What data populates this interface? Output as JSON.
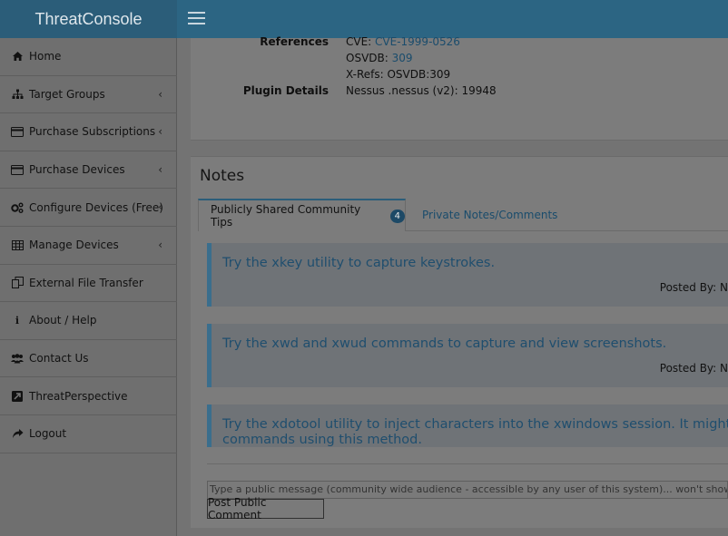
{
  "app": {
    "title": "ThreatConsole"
  },
  "sidebar": {
    "items": [
      {
        "label": "Home",
        "icon": "home-icon",
        "chevron": false
      },
      {
        "label": "Target Groups",
        "icon": "sitemap-icon",
        "chevron": true
      },
      {
        "label": "Purchase Subscriptions",
        "icon": "credit-card-icon",
        "chevron": true
      },
      {
        "label": "Purchase Devices",
        "icon": "credit-card-icon",
        "chevron": true
      },
      {
        "label": "Configure Devices (Free)",
        "icon": "gears-icon",
        "chevron": true
      },
      {
        "label": "Manage Devices",
        "icon": "table-icon",
        "chevron": true
      },
      {
        "label": "External File Transfer",
        "icon": "copy-icon",
        "chevron": false
      },
      {
        "label": "About / Help",
        "icon": "info-icon",
        "chevron": false
      },
      {
        "label": "Contact Us",
        "icon": "users-icon",
        "chevron": false
      },
      {
        "label": "ThreatPerspective",
        "icon": "external-link-icon",
        "chevron": false
      },
      {
        "label": "Logout",
        "icon": "share-icon",
        "chevron": false
      }
    ]
  },
  "references": {
    "label": "References",
    "cve_prefix": "CVE: ",
    "cve_link": "CVE-1999-0526",
    "osvdb_prefix": "OSVDB: ",
    "osvdb_link": "309",
    "xrefs": "X-Refs: OSVDB:309",
    "plugin_label": "Plugin Details",
    "plugin_value": "Nessus .nessus (v2): 19948"
  },
  "notes": {
    "title": "Notes",
    "tab_public": "Publicly Shared Community Tips",
    "tab_public_count": "4",
    "tab_private": "Private Notes/Comments",
    "tips": [
      {
        "text": "Try the xkey utility to capture keystrokes.",
        "posted_by": "Posted By: N"
      },
      {
        "text": "Try the xwd and xwud commands to capture and view screenshots.",
        "posted_by": "Posted By: N"
      },
      {
        "text": "Try the xdotool utility to inject characters into the xwindows session. It might be po",
        "text2": "commands using this method.",
        "posted_by": ""
      }
    ],
    "comment_placeholder": "Type a public message (community wide audience - accessible by any user of this system)... won't show up in",
    "post_button": "Post Public  Comment"
  },
  "colors": {
    "brand": "#2b5d79",
    "topbar": "#2c6583",
    "link": "#1a4c6c",
    "tip_accent": "#3a6e8d"
  }
}
